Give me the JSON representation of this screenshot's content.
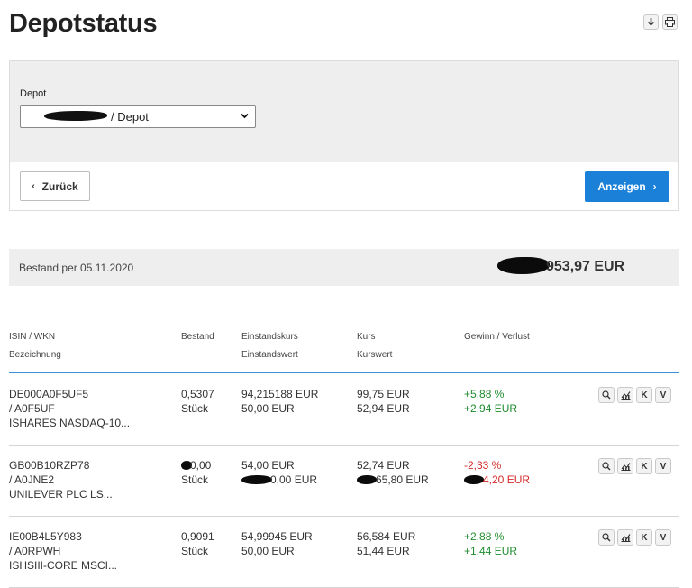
{
  "page": {
    "title": "Depotstatus"
  },
  "top_icons": [
    "download-icon",
    "print-icon"
  ],
  "form": {
    "depot_label": "Depot",
    "depot_select_suffix": "/ Depot",
    "back_label": "Zurück",
    "show_label": "Anzeigen"
  },
  "summary": {
    "bestand_label": "Bestand per 05.11.2020",
    "bestand_value": "953,97 EUR"
  },
  "table": {
    "headers": {
      "isin_wkn": "ISIN / WKN",
      "bezeichnung": "Bezeichnung",
      "bestand": "Bestand",
      "einstandskurs": "Einstandskurs",
      "einstandswert": "Einstandswert",
      "kurs": "Kurs",
      "kurswert": "Kurswert",
      "gewinn_verlust": "Gewinn / Verlust"
    },
    "row_actions": [
      "Q",
      "chart",
      "K",
      "V"
    ],
    "rows": [
      {
        "isin": "DE000A0F5UF5",
        "wkn": "/ A0F5UF",
        "name": "ISHARES NASDAQ-10...",
        "bestand": "0,5307",
        "einheit": "Stück",
        "einstandskurs": "94,215188 EUR",
        "einstandswert": "50,00 EUR",
        "kurs": "99,75 EUR",
        "kurswert": "52,94 EUR",
        "gv_prozent": "+5,88 %",
        "gv_wert": "+2,94 EUR",
        "trend": "pos"
      },
      {
        "isin": "GB00B10RZP78",
        "wkn": "/ A0JNE2",
        "name": "UNILEVER PLC LS...",
        "bestand": "0,00",
        "einheit": "Stück",
        "einstandskurs": "54,00 EUR",
        "einstandswert": "0,00 EUR",
        "kurs": "52,74 EUR",
        "kurswert": "65,80 EUR",
        "gv_prozent": "-2,33 %",
        "gv_wert": "4,20 EUR",
        "trend": "neg"
      },
      {
        "isin": "IE00B4L5Y983",
        "wkn": "/ A0RPWH",
        "name": "ISHSIII-CORE MSCI...",
        "bestand": "0,9091",
        "einheit": "Stück",
        "einstandskurs": "54,99945 EUR",
        "einstandswert": "50,00 EUR",
        "kurs": "56,584 EUR",
        "kurswert": "51,44 EUR",
        "gv_prozent": "+2,88 %",
        "gv_wert": "+1,44 EUR",
        "trend": "pos"
      }
    ]
  },
  "colors": {
    "accent": "#1a80d8",
    "positive": "#1f8c2e",
    "negative": "#d42b2b"
  }
}
